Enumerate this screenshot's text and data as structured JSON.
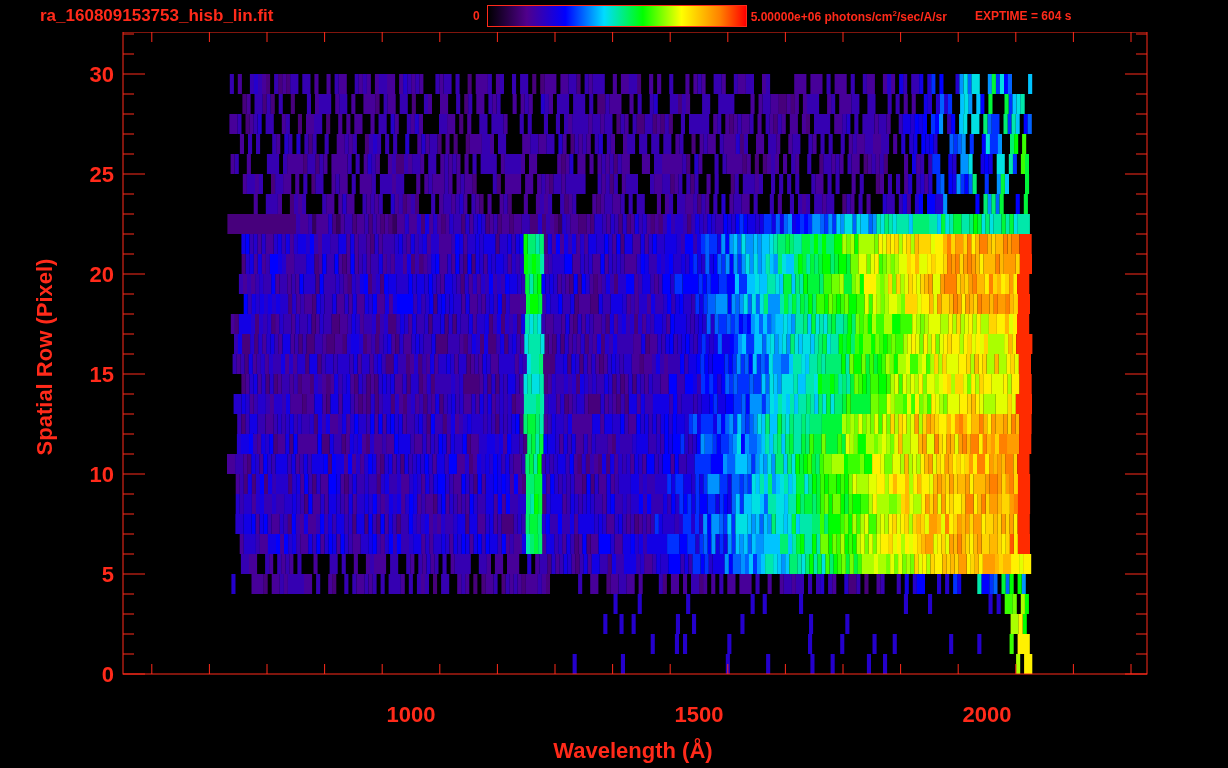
{
  "header": {
    "title": "ra_160809153753_hisb_lin.fit",
    "colorbar": {
      "min_label": "0",
      "max_label": "5.00000e+06 photons/cm$^{2}$/sec/A/sr"
    },
    "exposure": "EXPTIME = 604 s"
  },
  "plot": {
    "x_axis": {
      "label": "Wavelength (Å)",
      "ticks": [
        "1000",
        "1500",
        "2000"
      ]
    },
    "y_axis": {
      "label": "Spatial Row (Pixel)",
      "ticks": [
        "30",
        "25",
        "20",
        "15",
        "10",
        "5",
        "0"
      ]
    }
  }
}
